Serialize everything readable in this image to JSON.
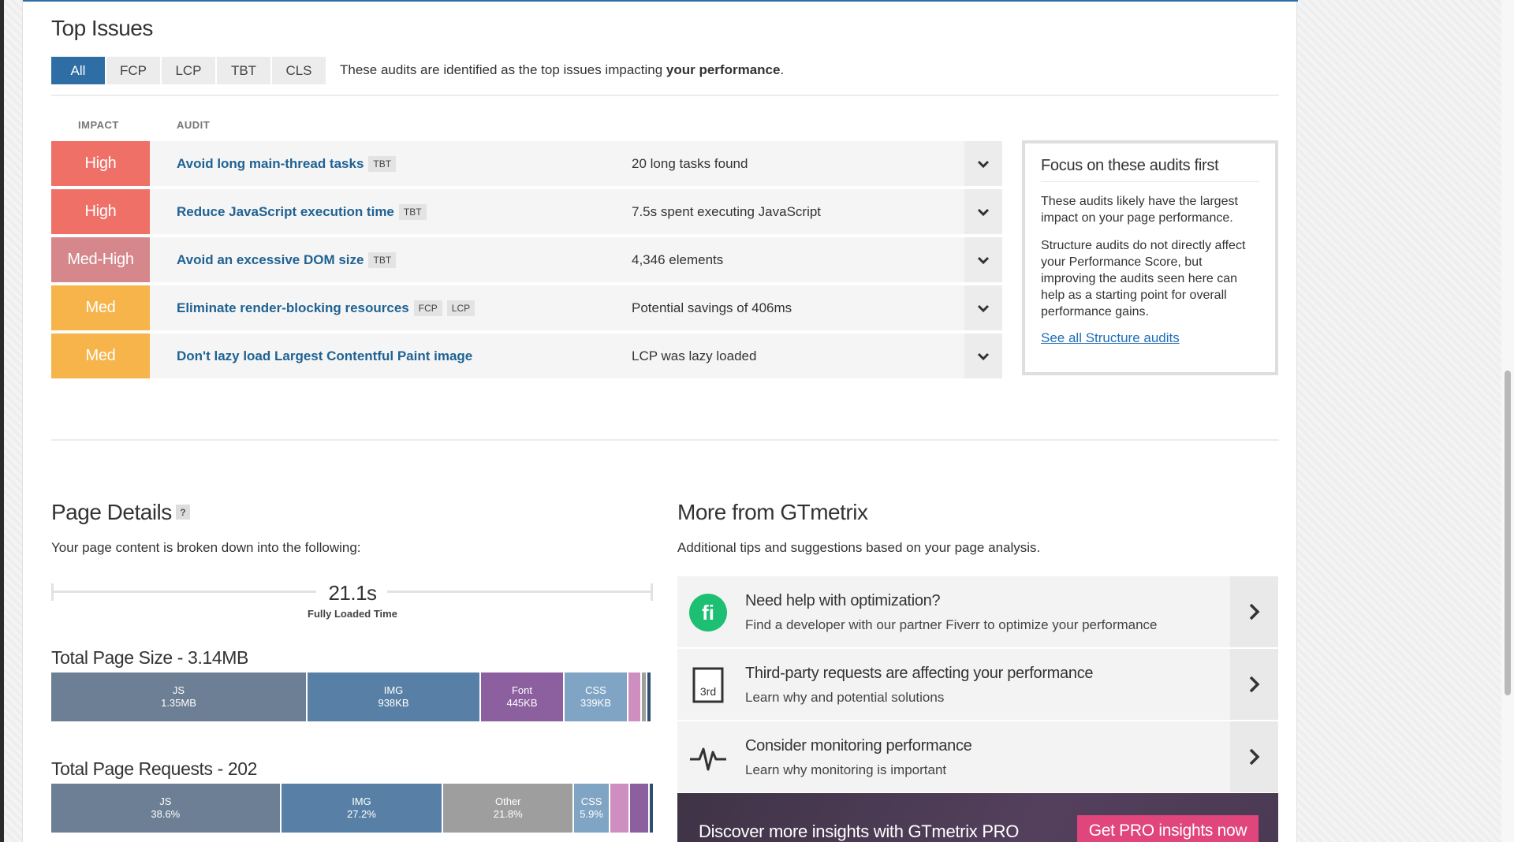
{
  "top_issues": {
    "title": "Top Issues",
    "tabs": [
      "All",
      "FCP",
      "LCP",
      "TBT",
      "CLS"
    ],
    "active_tab": "All",
    "description_prefix": "These audits are identified as the top issues impacting ",
    "description_bold": "your performance",
    "description_suffix": ".",
    "column_impact": "IMPACT",
    "column_audit": "AUDIT",
    "colors": {
      "high": "#ef7067",
      "med_high": "#d5878b",
      "med": "#f6b44b",
      "tab_active": "#2f6ea5",
      "link": "#1f6293"
    },
    "rows": [
      {
        "impact": "High",
        "title": "Avoid long main-thread tasks",
        "tags": [
          "TBT"
        ],
        "detail": "20 long tasks found"
      },
      {
        "impact": "High",
        "title": "Reduce JavaScript execution time",
        "tags": [
          "TBT"
        ],
        "detail": "7.5s spent executing JavaScript"
      },
      {
        "impact": "Med-High",
        "title": "Avoid an excessive DOM size",
        "tags": [
          "TBT"
        ],
        "detail": "4,346 elements"
      },
      {
        "impact": "Med",
        "title": "Eliminate render-blocking resources",
        "tags": [
          "FCP",
          "LCP"
        ],
        "detail": "Potential savings of 406ms"
      },
      {
        "impact": "Med",
        "title": "Don't lazy load Largest Contentful Paint image",
        "tags": [],
        "detail": "LCP was lazy loaded"
      }
    ],
    "focus": {
      "title": "Focus on these audits first",
      "p1": "These audits likely have the largest impact on your page performance.",
      "p2": "Structure audits do not directly affect your Performance Score, but improving the audits seen here can help as a starting point for overall performance gains.",
      "link": "See all Structure audits"
    }
  },
  "page_details": {
    "title": "Page Details",
    "help": "?",
    "subtitle": "Your page content is broken down into the following:",
    "fully_loaded_value": "21.1s",
    "fully_loaded_label": "Fully Loaded Time",
    "size_title": "Total Page Size - 3.14MB",
    "size_segments": [
      {
        "name": "JS",
        "value": "1.35MB",
        "fraction": 0.43,
        "color": "#6c7f94"
      },
      {
        "name": "IMG",
        "value": "938KB",
        "fraction": 0.29,
        "color": "#5880a6"
      },
      {
        "name": "Font",
        "value": "445KB",
        "fraction": 0.138,
        "color": "#8c5f9f"
      },
      {
        "name": "CSS",
        "value": "339KB",
        "fraction": 0.105,
        "color": "#80a4c4"
      },
      {
        "name": "",
        "value": "",
        "fraction": 0.02,
        "color": "#cf8ec0"
      },
      {
        "name": "",
        "value": "",
        "fraction": 0.006,
        "color": "#9e9e9e"
      },
      {
        "name": "",
        "value": "",
        "fraction": 0.005,
        "color": "#2e4f6e"
      }
    ],
    "requests_title": "Total Page Requests - 202",
    "request_segments": [
      {
        "name": "JS",
        "value": "38.6%",
        "fraction": 0.386,
        "color": "#6c7f94"
      },
      {
        "name": "IMG",
        "value": "27.2%",
        "fraction": 0.272,
        "color": "#5880a6"
      },
      {
        "name": "Other",
        "value": "21.8%",
        "fraction": 0.218,
        "color": "#9e9e9e"
      },
      {
        "name": "CSS",
        "value": "5.9%",
        "fraction": 0.059,
        "color": "#80a4c4"
      },
      {
        "name": "",
        "value": "",
        "fraction": 0.03,
        "color": "#cf8ec0"
      },
      {
        "name": "",
        "value": "",
        "fraction": 0.03,
        "color": "#8c5f9f"
      },
      {
        "name": "",
        "value": "",
        "fraction": 0.005,
        "color": "#2e4f6e"
      }
    ]
  },
  "more": {
    "title": "More from GTmetrix",
    "subtitle": "Additional tips and suggestions based on your page analysis.",
    "items": [
      {
        "icon": "fiverr-icon",
        "title": "Need help with optimization?",
        "sub": "Find a developer with our partner Fiverr to optimize your performance",
        "icon_text": "fi"
      },
      {
        "icon": "third-party-icon",
        "title": "Third-party requests are affecting your performance",
        "sub": "Learn why and potential solutions",
        "icon_text": "3rd"
      },
      {
        "icon": "pulse-icon",
        "title": "Consider monitoring performance",
        "sub": "Learn why monitoring is important"
      }
    ],
    "pro_text": "Discover more insights with GTmetrix PRO",
    "pro_button": "Get PRO insights now"
  }
}
